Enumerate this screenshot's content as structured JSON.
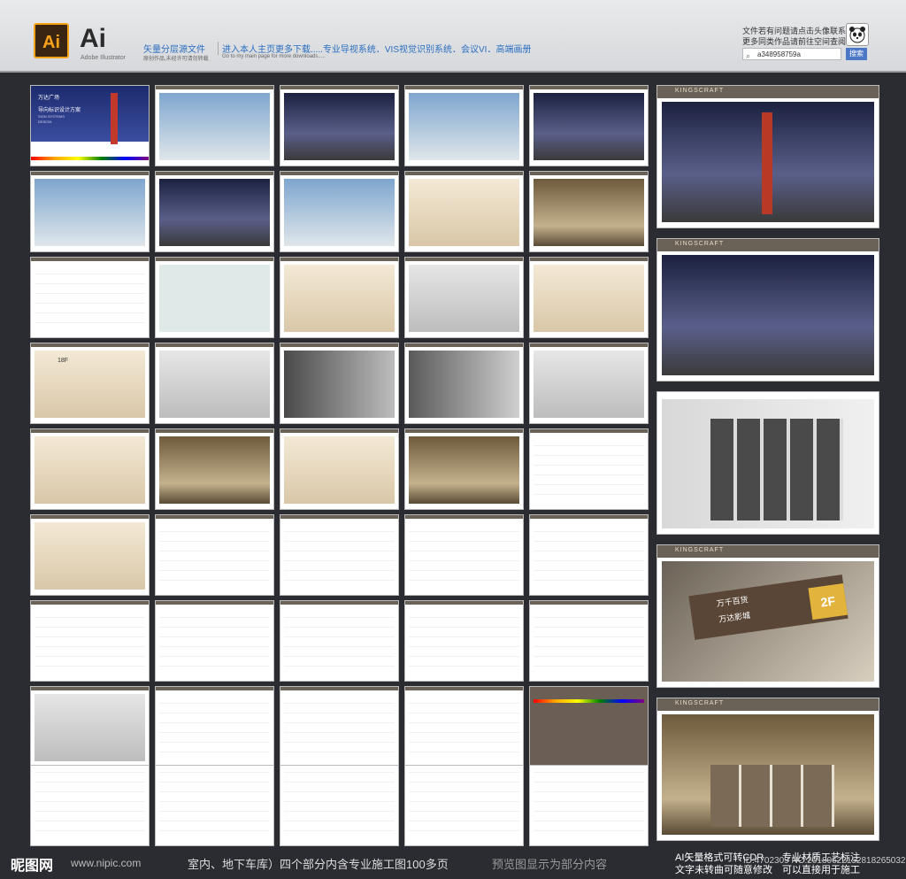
{
  "header": {
    "ai_badge": "Ai",
    "ai_title": "Ai",
    "ai_subtitle": "Adobe Illustrator",
    "vector_title": "矢量分层源文件",
    "vector_sub": "原创作品,未经许可请勿转载",
    "nav_text": "进入本人主页更多下载.....专业导视系统．VIS视觉识别系统．会议VI．高端画册",
    "nav_sub": "Go to my main page for more downloads.....",
    "contact_line1": "文件若有问题请点击头像联系",
    "contact_line2": "更多同类作品请前往空间查阅",
    "search_value": "a348958759a",
    "search_button": "搜索"
  },
  "thumb_cover": {
    "brand": "万达广场",
    "title": "导向标识设计方案",
    "sub1": "SIGN SYSTEMS",
    "sub2": "DESIGN"
  },
  "big_panels": [
    {
      "header": "KINGSCRAFT"
    },
    {
      "header": "KINGSCRAFT"
    },
    {
      "header": ""
    },
    {
      "header": "KINGSCRAFT"
    },
    {
      "header": "KINGSCRAFT"
    }
  ],
  "sign_labels": {
    "floor": "2F",
    "name1": "万千百货",
    "name2": "万达影城",
    "floor_small": "18F"
  },
  "footer": {
    "logo": "昵图网",
    "url": "www.nipic.com",
    "text": "室内、地下车库）四个部分内含专业施工图100多页",
    "text2": "预览图显示为部分内容",
    "right1": "AI矢量格式可转CDR",
    "right2": "文字未转曲可随意修改",
    "right3": "专业材质工艺标注",
    "right4": "可以直接用于施工",
    "id": "ID:4702309 NO:20180622152818265032"
  },
  "colors": {
    "accent": "#2a6fc1",
    "ai_orange": "#f6a21b",
    "panel_header": "#6a6157",
    "sign_gold": "#e3b43c"
  }
}
